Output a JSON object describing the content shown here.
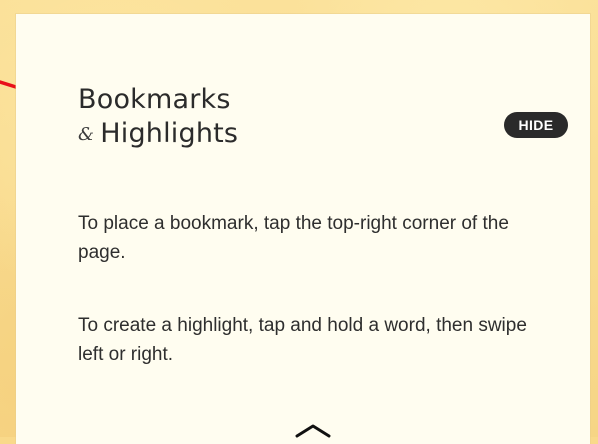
{
  "panel": {
    "title_line1": "Bookmarks",
    "title_ampersand": "&",
    "title_line2": "Highlights",
    "hide_label": "HIDE",
    "instruction_bookmark": "To place a bookmark, tap the top-right corner of the page.",
    "instruction_highlight": "To create a highlight, tap and hold a word, then swipe left or right."
  },
  "icons": {
    "pointer_arrow": "arrow-right-icon",
    "expand": "chevron-up-icon"
  },
  "colors": {
    "background": "#f9d98a",
    "card": "#fffdf0",
    "text": "#2e2e2e",
    "hide_button": "#2a2a2a",
    "arrow": "#e8101a"
  }
}
